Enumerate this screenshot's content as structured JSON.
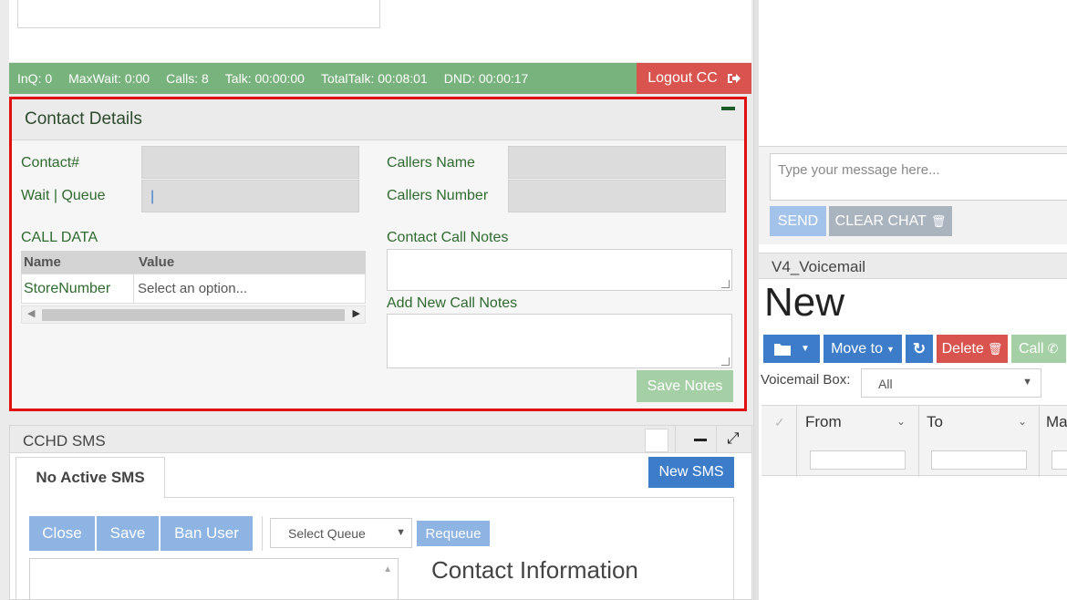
{
  "status_bar": {
    "items": [
      "InQ: 0",
      "MaxWait: 0:00",
      "Calls: 8",
      "Talk: 00:00:00",
      "TotalTalk: 00:08:01",
      "DND: 00:00:17"
    ],
    "logout_label": "Logout CC",
    "logout_icon": "sign-out-icon"
  },
  "contact_details": {
    "title": "Contact Details",
    "contact_label": "Contact#",
    "wait_queue_label": "Wait | Queue",
    "wait_queue_value": "|",
    "callers_name_label": "Callers Name",
    "callers_number_label": "Callers Number",
    "call_data_label": "CALL DATA",
    "table_headers": [
      "Name",
      "Value"
    ],
    "table_rows": [
      {
        "name": "StoreNumber",
        "value_placeholder": "Select an option..."
      }
    ],
    "contact_call_notes_label": "Contact Call Notes",
    "add_new_call_notes_label": "Add New Call Notes",
    "save_notes_label": "Save Notes"
  },
  "sms": {
    "title": "CCHD SMS",
    "tab_label": "No Active SMS",
    "new_sms_label": "New SMS",
    "buttons": [
      "Close",
      "Save",
      "Ban User"
    ],
    "select_queue_placeholder": "Select Queue",
    "requeue_label": "Requeue",
    "contact_info_title": "Contact Information"
  },
  "chat": {
    "input_placeholder": "Type your message here...",
    "send_label": "SEND",
    "clear_label": "CLEAR CHAT"
  },
  "voicemail": {
    "panel_title": "V4_Voicemail",
    "heading": "New",
    "move_to_label": "Move to",
    "delete_label": "Delete",
    "call_label": "Call",
    "box_label": "Voicemail Box:",
    "box_value": "All",
    "columns": [
      "From",
      "To",
      "Ma"
    ]
  },
  "colors": {
    "status_green": "#78b27c",
    "logout_red": "#d9534f",
    "highlight_red": "#e01010",
    "primary_blue": "#3d7cc9",
    "label_green": "#2f6a2f"
  }
}
